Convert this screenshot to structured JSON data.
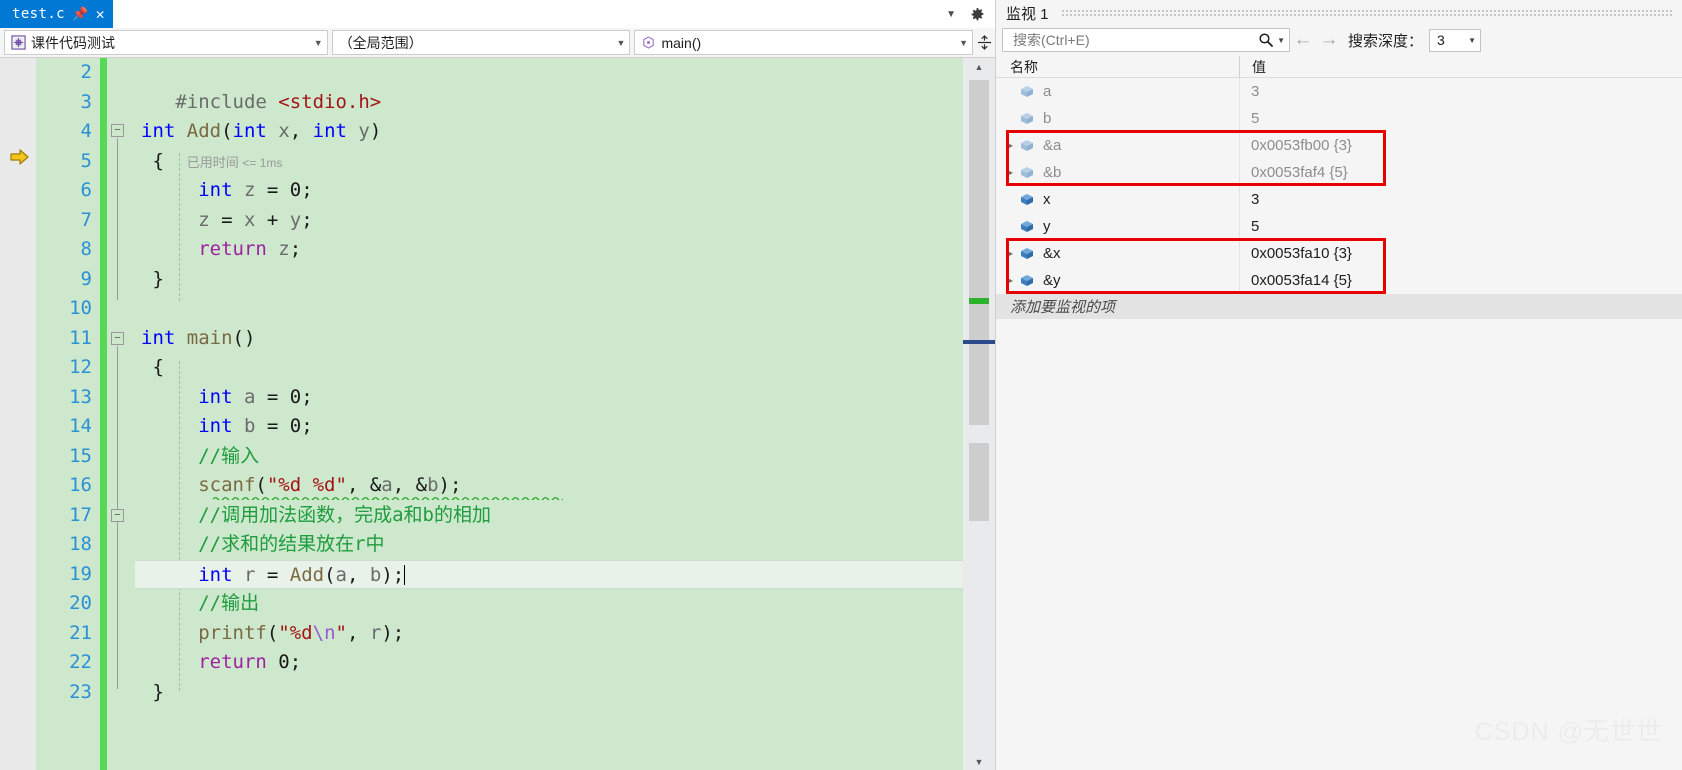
{
  "editor": {
    "tab": {
      "title": "test.c",
      "pin_icon": "pin-icon",
      "close_icon": "close-icon"
    },
    "tabstrip_right": {
      "dropdown_icon": "chevron-down-icon",
      "settings_icon": "gear-icon"
    },
    "navbar": {
      "project_combo": {
        "value": "课件代码测试",
        "icon": "project-icon"
      },
      "scope_combo": {
        "value": "（全局范围）"
      },
      "member_combo": {
        "value": "main()",
        "icon": "method-icon"
      },
      "split_icon": "split-window-icon"
    },
    "gutter": {
      "current_line_icon": "yellow-execution-arrow",
      "current_line": 5
    },
    "first_line_number": 2,
    "inline_hint": {
      "text": "已用时间",
      "value": "<= 1ms"
    },
    "lines": [
      {
        "n": 2,
        "text": ""
      },
      {
        "n": 3,
        "text": "#include <stdio.h>"
      },
      {
        "n": 4,
        "text": "int Add(int x, int y)"
      },
      {
        "n": 5,
        "text": "{   已用时间 <= 1ms"
      },
      {
        "n": 6,
        "text": "    int z = 0;"
      },
      {
        "n": 7,
        "text": "    z = x + y;"
      },
      {
        "n": 8,
        "text": "    return z;"
      },
      {
        "n": 9,
        "text": "}"
      },
      {
        "n": 10,
        "text": ""
      },
      {
        "n": 11,
        "text": "int main()"
      },
      {
        "n": 12,
        "text": "{"
      },
      {
        "n": 13,
        "text": "    int a = 0;"
      },
      {
        "n": 14,
        "text": "    int b = 0;"
      },
      {
        "n": 15,
        "text": "    //输入"
      },
      {
        "n": 16,
        "text": "    scanf(\"%d %d\", &a, &b);"
      },
      {
        "n": 17,
        "text": "    //调用加法函数，完成a和b的相加"
      },
      {
        "n": 18,
        "text": "    //求和的结果放在r中"
      },
      {
        "n": 19,
        "text": "    int r = Add(a, b);"
      },
      {
        "n": 20,
        "text": "    //输出"
      },
      {
        "n": 21,
        "text": "    printf(\"%d\\n\", r);"
      },
      {
        "n": 22,
        "text": "    return 0;"
      },
      {
        "n": 23,
        "text": "}"
      }
    ],
    "scrollbar": {
      "up_icon": "scroll-up-arrow",
      "down_icon": "scroll-down-arrow"
    }
  },
  "watch": {
    "title": "监视 1",
    "search": {
      "placeholder": "搜索(Ctrl+E)",
      "value": "",
      "icon": "search-icon",
      "dropdown_icon": "chevron-down-icon"
    },
    "prev_icon": "arrow-left-icon",
    "next_icon": "arrow-right-icon",
    "depth_label": "搜索深度：",
    "depth_value": "3",
    "columns": {
      "name": "名称",
      "value": "值"
    },
    "rows": [
      {
        "name": "a",
        "value": "3",
        "expandable": false,
        "stale": true
      },
      {
        "name": "b",
        "value": "5",
        "expandable": false,
        "stale": true
      },
      {
        "name": "&a",
        "value": "0x0053fb00 {3}",
        "expandable": true,
        "stale": true
      },
      {
        "name": "&b",
        "value": "0x0053faf4 {5}",
        "expandable": true,
        "stale": true
      },
      {
        "name": "x",
        "value": "3",
        "expandable": false,
        "stale": false
      },
      {
        "name": "y",
        "value": "5",
        "expandable": false,
        "stale": false
      },
      {
        "name": "&x",
        "value": "0x0053fa10 {3}",
        "expandable": true,
        "stale": false
      },
      {
        "name": "&y",
        "value": "0x0053fa14 {5}",
        "expandable": true,
        "stale": false
      }
    ],
    "add_row_text": "添加要监视的项",
    "highlight_color": "#e60000"
  },
  "watermark": "CSDN @无世世"
}
